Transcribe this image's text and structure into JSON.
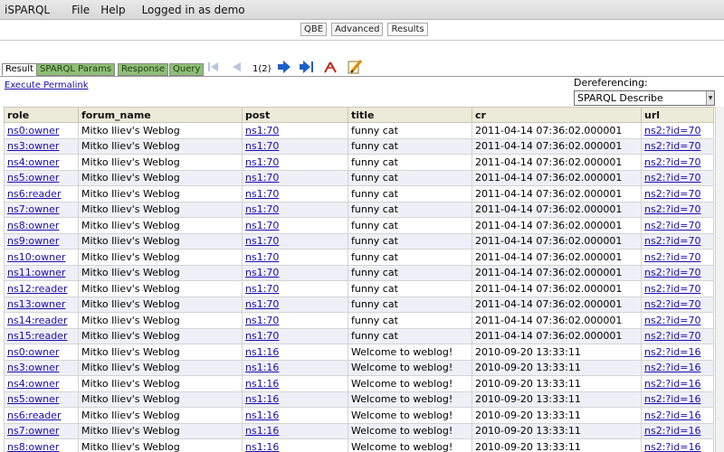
{
  "menu": {
    "app": "iSPARQL",
    "file": "File",
    "help": "Help",
    "user": "Logged in as demo"
  },
  "view_tabs": [
    "QBE",
    "Advanced",
    "Results"
  ],
  "result_tabs": [
    "Result",
    "SPARQL Params",
    "Response",
    "Query"
  ],
  "toolbar": {
    "page_counter": "1(2)",
    "icons": [
      "first-page-icon",
      "previous-page-icon",
      "next-page-icon",
      "last-page-icon",
      "graph-view-icon",
      "edit-icon"
    ]
  },
  "permalink": "Execute Permalink",
  "dereferencing": {
    "label": "Dereferencing:",
    "value": "SPARQL Describe"
  },
  "table": {
    "columns": [
      "role",
      "forum_name",
      "post",
      "title",
      "cr",
      "url"
    ],
    "rows": [
      [
        "ns0:owner",
        "Mitko Iliev's Weblog",
        "ns1:70",
        "funny cat",
        "2011-04-14 07:36:02.000001",
        "ns2:?id=70"
      ],
      [
        "ns3:owner",
        "Mitko Iliev's Weblog",
        "ns1:70",
        "funny cat",
        "2011-04-14 07:36:02.000001",
        "ns2:?id=70"
      ],
      [
        "ns4:owner",
        "Mitko Iliev's Weblog",
        "ns1:70",
        "funny cat",
        "2011-04-14 07:36:02.000001",
        "ns2:?id=70"
      ],
      [
        "ns5:owner",
        "Mitko Iliev's Weblog",
        "ns1:70",
        "funny cat",
        "2011-04-14 07:36:02.000001",
        "ns2:?id=70"
      ],
      [
        "ns6:reader",
        "Mitko Iliev's Weblog",
        "ns1:70",
        "funny cat",
        "2011-04-14 07:36:02.000001",
        "ns2:?id=70"
      ],
      [
        "ns7:owner",
        "Mitko Iliev's Weblog",
        "ns1:70",
        "funny cat",
        "2011-04-14 07:36:02.000001",
        "ns2:?id=70"
      ],
      [
        "ns8:owner",
        "Mitko Iliev's Weblog",
        "ns1:70",
        "funny cat",
        "2011-04-14 07:36:02.000001",
        "ns2:?id=70"
      ],
      [
        "ns9:owner",
        "Mitko Iliev's Weblog",
        "ns1:70",
        "funny cat",
        "2011-04-14 07:36:02.000001",
        "ns2:?id=70"
      ],
      [
        "ns10:owner",
        "Mitko Iliev's Weblog",
        "ns1:70",
        "funny cat",
        "2011-04-14 07:36:02.000001",
        "ns2:?id=70"
      ],
      [
        "ns11:owner",
        "Mitko Iliev's Weblog",
        "ns1:70",
        "funny cat",
        "2011-04-14 07:36:02.000001",
        "ns2:?id=70"
      ],
      [
        "ns12:reader",
        "Mitko Iliev's Weblog",
        "ns1:70",
        "funny cat",
        "2011-04-14 07:36:02.000001",
        "ns2:?id=70"
      ],
      [
        "ns13:owner",
        "Mitko Iliev's Weblog",
        "ns1:70",
        "funny cat",
        "2011-04-14 07:36:02.000001",
        "ns2:?id=70"
      ],
      [
        "ns14:reader",
        "Mitko Iliev's Weblog",
        "ns1:70",
        "funny cat",
        "2011-04-14 07:36:02.000001",
        "ns2:?id=70"
      ],
      [
        "ns15:reader",
        "Mitko Iliev's Weblog",
        "ns1:70",
        "funny cat",
        "2011-04-14 07:36:02.000001",
        "ns2:?id=70"
      ],
      [
        "ns0:owner",
        "Mitko Iliev's Weblog",
        "ns1:16",
        "Welcome to weblog!",
        "2010-09-20 13:33:11",
        "ns2:?id=16"
      ],
      [
        "ns3:owner",
        "Mitko Iliev's Weblog",
        "ns1:16",
        "Welcome to weblog!",
        "2010-09-20 13:33:11",
        "ns2:?id=16"
      ],
      [
        "ns4:owner",
        "Mitko Iliev's Weblog",
        "ns1:16",
        "Welcome to weblog!",
        "2010-09-20 13:33:11",
        "ns2:?id=16"
      ],
      [
        "ns5:owner",
        "Mitko Iliev's Weblog",
        "ns1:16",
        "Welcome to weblog!",
        "2010-09-20 13:33:11",
        "ns2:?id=16"
      ],
      [
        "ns6:reader",
        "Mitko Iliev's Weblog",
        "ns1:16",
        "Welcome to weblog!",
        "2010-09-20 13:33:11",
        "ns2:?id=16"
      ],
      [
        "ns7:owner",
        "Mitko Iliev's Weblog",
        "ns1:16",
        "Welcome to weblog!",
        "2010-09-20 13:33:11",
        "ns2:?id=16"
      ],
      [
        "ns8:owner",
        "Mitko Iliev's Weblog",
        "ns1:16",
        "Welcome to weblog!",
        "2010-09-20 13:33:11",
        "ns2:?id=16"
      ]
    ]
  }
}
